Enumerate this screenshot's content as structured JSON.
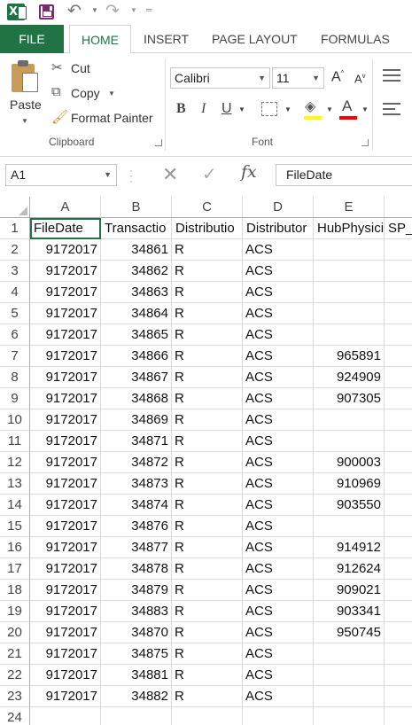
{
  "qat": {
    "app_icon_letter": "X"
  },
  "tabs": [
    "FILE",
    "HOME",
    "INSERT",
    "PAGE LAYOUT",
    "FORMULAS"
  ],
  "ribbon": {
    "paste": "Paste",
    "cut": "Cut",
    "copy": "Copy",
    "format_painter": "Format Painter",
    "clipboard_label": "Clipboard",
    "font_name": "Calibri",
    "font_size": "11",
    "grow_font": "A",
    "shrink_font": "A",
    "bold": "B",
    "italic": "I",
    "underline": "U",
    "font_color_glyph": "A",
    "font_label": "Font",
    "fill_color": "#ffff00",
    "font_color": "#ff0000"
  },
  "formula_bar": {
    "name_box": "A1",
    "content": "FileDate",
    "fx": "fx"
  },
  "sheet": {
    "columns": [
      "A",
      "B",
      "C",
      "D",
      "E",
      "SP_"
    ],
    "rows": [
      {
        "n": "1",
        "a": "FileDate",
        "b": "Transactio",
        "c": "Distributio",
        "d": "Distributor",
        "e": "HubPhysici",
        "f": "SP_"
      },
      {
        "n": "2",
        "a": "9172017",
        "b": "34861",
        "c": "R",
        "d": "ACS",
        "e": "",
        "f": ""
      },
      {
        "n": "3",
        "a": "9172017",
        "b": "34862",
        "c": "R",
        "d": "ACS",
        "e": "",
        "f": ""
      },
      {
        "n": "4",
        "a": "9172017",
        "b": "34863",
        "c": "R",
        "d": "ACS",
        "e": "",
        "f": ""
      },
      {
        "n": "5",
        "a": "9172017",
        "b": "34864",
        "c": "R",
        "d": "ACS",
        "e": "",
        "f": ""
      },
      {
        "n": "6",
        "a": "9172017",
        "b": "34865",
        "c": "R",
        "d": "ACS",
        "e": "",
        "f": ""
      },
      {
        "n": "7",
        "a": "9172017",
        "b": "34866",
        "c": "R",
        "d": "ACS",
        "e": "965891",
        "f": ""
      },
      {
        "n": "8",
        "a": "9172017",
        "b": "34867",
        "c": "R",
        "d": "ACS",
        "e": "924909",
        "f": ""
      },
      {
        "n": "9",
        "a": "9172017",
        "b": "34868",
        "c": "R",
        "d": "ACS",
        "e": "907305",
        "f": ""
      },
      {
        "n": "10",
        "a": "9172017",
        "b": "34869",
        "c": "R",
        "d": "ACS",
        "e": "",
        "f": ""
      },
      {
        "n": "11",
        "a": "9172017",
        "b": "34871",
        "c": "R",
        "d": "ACS",
        "e": "",
        "f": ""
      },
      {
        "n": "12",
        "a": "9172017",
        "b": "34872",
        "c": "R",
        "d": "ACS",
        "e": "900003",
        "f": ""
      },
      {
        "n": "13",
        "a": "9172017",
        "b": "34873",
        "c": "R",
        "d": "ACS",
        "e": "910969",
        "f": ""
      },
      {
        "n": "14",
        "a": "9172017",
        "b": "34874",
        "c": "R",
        "d": "ACS",
        "e": "903550",
        "f": ""
      },
      {
        "n": "15",
        "a": "9172017",
        "b": "34876",
        "c": "R",
        "d": "ACS",
        "e": "",
        "f": ""
      },
      {
        "n": "16",
        "a": "9172017",
        "b": "34877",
        "c": "R",
        "d": "ACS",
        "e": "914912",
        "f": ""
      },
      {
        "n": "17",
        "a": "9172017",
        "b": "34878",
        "c": "R",
        "d": "ACS",
        "e": "912624",
        "f": ""
      },
      {
        "n": "18",
        "a": "9172017",
        "b": "34879",
        "c": "R",
        "d": "ACS",
        "e": "909021",
        "f": ""
      },
      {
        "n": "19",
        "a": "9172017",
        "b": "34883",
        "c": "R",
        "d": "ACS",
        "e": "903341",
        "f": ""
      },
      {
        "n": "20",
        "a": "9172017",
        "b": "34870",
        "c": "R",
        "d": "ACS",
        "e": "950745",
        "f": ""
      },
      {
        "n": "21",
        "a": "9172017",
        "b": "34875",
        "c": "R",
        "d": "ACS",
        "e": "",
        "f": ""
      },
      {
        "n": "22",
        "a": "9172017",
        "b": "34881",
        "c": "R",
        "d": "ACS",
        "e": "",
        "f": ""
      },
      {
        "n": "23",
        "a": "9172017",
        "b": "34882",
        "c": "R",
        "d": "ACS",
        "e": "",
        "f": ""
      },
      {
        "n": "24",
        "a": "",
        "b": "",
        "c": "",
        "d": "",
        "e": "",
        "f": ""
      }
    ]
  }
}
